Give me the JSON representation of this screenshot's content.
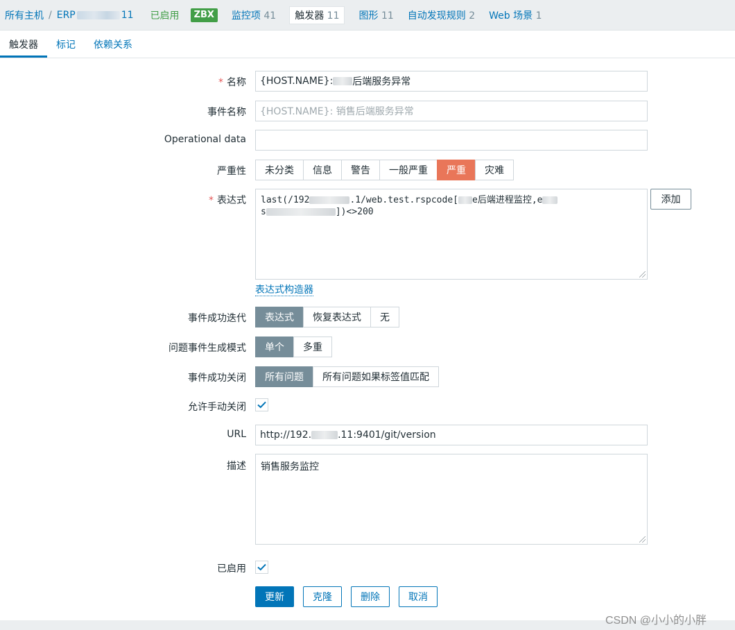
{
  "breadcrumb": {
    "all_hosts": "所有主机",
    "host_prefix": "ERP",
    "host_suffix": "11",
    "status": "已启用",
    "badge": "ZBX",
    "nav": [
      {
        "label": "监控项",
        "count": "41"
      },
      {
        "label": "触发器",
        "count": "11"
      },
      {
        "label": "图形",
        "count": "11"
      },
      {
        "label": "自动发现规则",
        "count": "2"
      },
      {
        "label": "Web 场景",
        "count": "1"
      }
    ]
  },
  "tabs": [
    "触发器",
    "标记",
    "依赖关系"
  ],
  "form": {
    "name": {
      "label": "名称",
      "value_prefix": "{HOST.NAME}: ",
      "value_suffix": "后端服务异常"
    },
    "event_name": {
      "label": "事件名称",
      "placeholder": "{HOST.NAME}: 销售后端服务异常"
    },
    "operational_data": {
      "label": "Operational data",
      "value": ""
    },
    "severity": {
      "label": "严重性",
      "options": [
        "未分类",
        "信息",
        "警告",
        "一般严重",
        "严重",
        "灾难"
      ],
      "selected": "严重"
    },
    "expression": {
      "label": "表达式",
      "part1": "last(/192",
      "part2": ".1/web.test.rspcode[",
      "part3": "e后端进程监控,e",
      "part4": "s",
      "part5": "])<>200",
      "add_button": "添加",
      "builder_link": "表达式构造器"
    },
    "ok_event_generation": {
      "label": "事件成功迭代",
      "options": [
        "表达式",
        "恢复表达式",
        "无"
      ],
      "selected": "表达式"
    },
    "problem_event_mode": {
      "label": "问题事件生成模式",
      "options": [
        "单个",
        "多重"
      ],
      "selected": "单个"
    },
    "ok_event_closes": {
      "label": "事件成功关闭",
      "options": [
        "所有问题",
        "所有问题如果标签值匹配"
      ],
      "selected": "所有问题"
    },
    "allow_manual_close": {
      "label": "允许手动关闭",
      "checked": true
    },
    "url": {
      "label": "URL",
      "value_prefix": "http://192.",
      "value_suffix": ".11:9401/git/version"
    },
    "description": {
      "label": "描述",
      "value": "销售服务监控"
    },
    "enabled": {
      "label": "已启用",
      "checked": true
    }
  },
  "buttons": {
    "update": "更新",
    "clone": "克隆",
    "delete": "删除",
    "cancel": "取消"
  },
  "watermark": "CSDN @小小的小胖",
  "colors": {
    "link": "#0275b8",
    "enabled_green": "#429e47",
    "severity_high": "#e97659",
    "selected_gray": "#768d99"
  }
}
